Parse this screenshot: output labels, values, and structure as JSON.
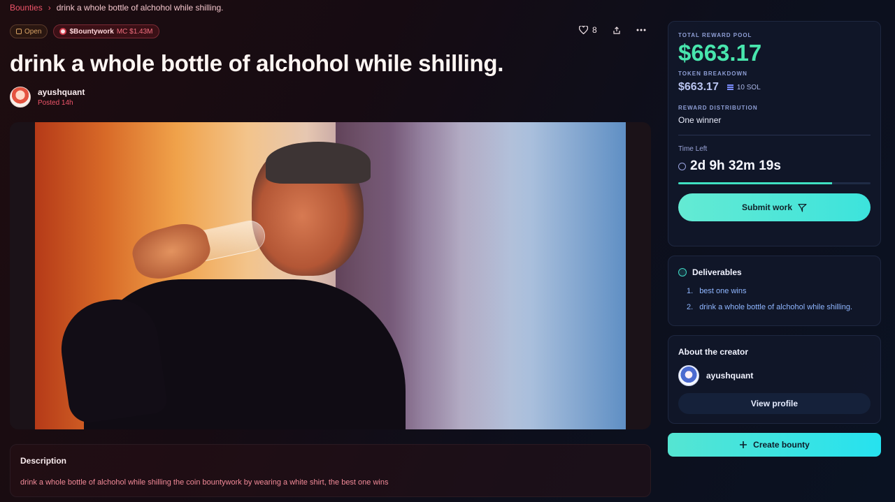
{
  "breadcrumb": {
    "root": "Bounties",
    "current": "drink a whole bottle of alchohol while shilling."
  },
  "badges": {
    "status": "Open",
    "token": "$Bountywork",
    "market_cap": "MC $1.43M"
  },
  "actions": {
    "likes": "8",
    "like_icon": "heart-icon",
    "share_icon": "share-icon",
    "more_icon": "more-icon"
  },
  "bounty": {
    "title": "drink a whole bottle of alchohol while shilling.",
    "author": "ayushquant",
    "posted": "Posted 14h",
    "description_heading": "Description",
    "description": "drink a whole bottle of alchohol while shilling the coin bountywork by wearing a white shirt, the best one wins"
  },
  "reward": {
    "pool_label": "TOTAL REWARD POOL",
    "pool_value": "$663.17",
    "breakdown_label": "TOKEN BREAKDOWN",
    "breakdown_value": "$663.17",
    "sol_amount": "10 SOL",
    "distribution_label": "REWARD DISTRIBUTION",
    "distribution_value": "One winner",
    "time_left_label": "Time Left",
    "time_left": "2d 9h 32m 19s",
    "time_progress": 0.8,
    "submit_label": "Submit work"
  },
  "deliverables": {
    "heading": "Deliverables",
    "items": [
      {
        "num": "1.",
        "text": "best one wins"
      },
      {
        "num": "2.",
        "text": "drink a whole bottle of alchohol while shilling."
      }
    ]
  },
  "creator": {
    "heading": "About the creator",
    "name": "ayushquant",
    "view_label": "View profile"
  },
  "create_button": {
    "label": "Create bounty"
  },
  "colors": {
    "accent_red": "#f0556a",
    "accent_green": "#48e6ad",
    "accent_cyan": "#3ce3dc"
  }
}
